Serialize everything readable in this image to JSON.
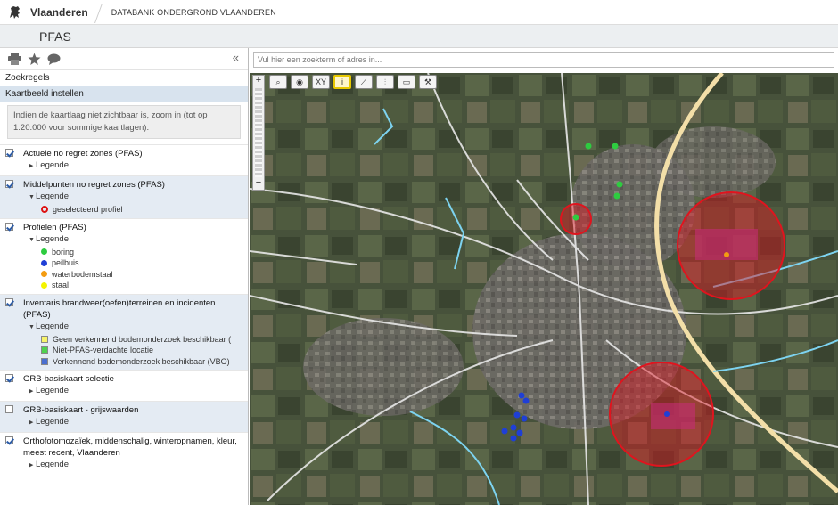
{
  "header": {
    "brand": "Vlaanderen",
    "subtitle": "DATABANK ONDERGROND VLAANDEREN",
    "page_title": "PFAS"
  },
  "sidebar": {
    "sections": [
      "Zoekregels",
      "Kaartbeeld instellen"
    ],
    "note": "Indien de kaartlaag niet zichtbaar is, zoom in (tot op 1:20.000 voor sommige kaartlagen).",
    "legend_label": "Legende",
    "layers": [
      {
        "name": "Actuele no regret zones (PFAS)",
        "checked": true
      },
      {
        "name": "Middelpunten no regret zones (PFAS)",
        "checked": true,
        "legend": [
          "geselecteerd profiel"
        ]
      },
      {
        "name": "Profielen (PFAS)",
        "checked": true,
        "legend": [
          "boring",
          "peilbuis",
          "waterbodemstaal",
          "staal"
        ]
      },
      {
        "name": "Inventaris brandweer(oefen)terreinen en incidenten (PFAS)",
        "checked": true,
        "legend": [
          "Geen verkennend bodemonderzoek beschikbaar (",
          "Niet-PFAS-verdachte locatie",
          "Verkennend bodemonderzoek beschikbaar (VBO)"
        ]
      },
      {
        "name": "GRB-basiskaart selectie",
        "checked": true
      },
      {
        "name": "GRB-basiskaart - grijswaarden",
        "checked": false
      },
      {
        "name": "Orthofotomozaïek, middenschalig, winteropnamen, kleur, meest recent, Vlaanderen",
        "checked": true
      }
    ]
  },
  "search": {
    "placeholder": "Vul hier een zoekterm of adres in..."
  },
  "map_tools": {
    "xy": "XY",
    "info": "i"
  },
  "colors": {
    "boring": "#2ecc40",
    "peilbuis": "#1f3fd6",
    "waterbodemstaal": "#f39c12",
    "staal": "#f4f400",
    "zone": "#e0141e"
  }
}
